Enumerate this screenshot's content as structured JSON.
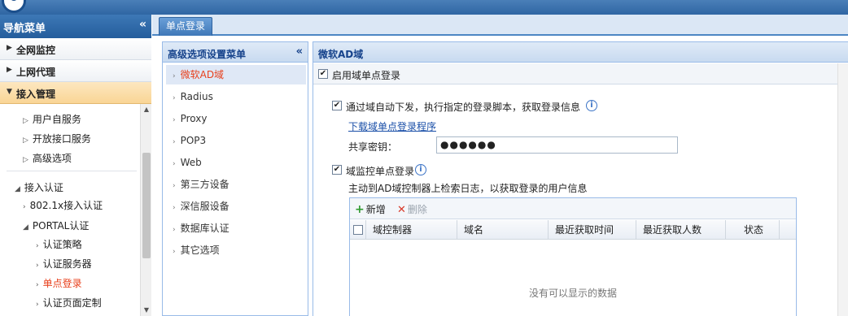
{
  "nav": {
    "title": "导航菜单",
    "collapse_icon": "«",
    "sections": [
      {
        "label": "全网监控"
      },
      {
        "label": "上网代理"
      },
      {
        "label": "接入管理"
      }
    ],
    "tree": [
      {
        "label": "用户自服务"
      },
      {
        "label": "开放接口服务"
      },
      {
        "label": "高级选项"
      },
      {
        "label": "接入认证"
      },
      {
        "label": "802.1x接入认证"
      },
      {
        "label": "PORTAL认证"
      },
      {
        "label": "认证策略"
      },
      {
        "label": "认证服务器"
      },
      {
        "label": "单点登录"
      },
      {
        "label": "认证页面定制"
      }
    ]
  },
  "tabs": [
    {
      "label": "单点登录"
    }
  ],
  "settings_menu": {
    "title": "高级选项设置菜单",
    "collapse_icon": "«",
    "items": [
      {
        "label": "微软AD域"
      },
      {
        "label": "Radius"
      },
      {
        "label": "Proxy"
      },
      {
        "label": "POP3"
      },
      {
        "label": "Web"
      },
      {
        "label": "第三方设备"
      },
      {
        "label": "深信服设备"
      },
      {
        "label": "数据库认证"
      },
      {
        "label": "其它选项"
      }
    ]
  },
  "content": {
    "title": "微软AD域",
    "enable_label": "启用域单点登录",
    "option1_label": "通过域自动下发，执行指定的登录脚本，获取登录信息",
    "download_link": "下载域单点登录程序",
    "key_label": "共享密钥：",
    "key_value": "●●●●●●",
    "option2_label": "域监控单点登录",
    "option2_desc": "主动到AD域控制器上检索日志，以获取登录的用户信息",
    "grid": {
      "add_label": "新增",
      "delete_label": "删除",
      "columns": [
        "域控制器",
        "域名",
        "最近获取时间",
        "最近获取人数",
        "状态"
      ],
      "empty_text": "没有可以显示的数据"
    }
  },
  "colors": {
    "selected_text": "#e8401c",
    "header_blue": "#245d9c",
    "active_section": "#f9d595"
  }
}
